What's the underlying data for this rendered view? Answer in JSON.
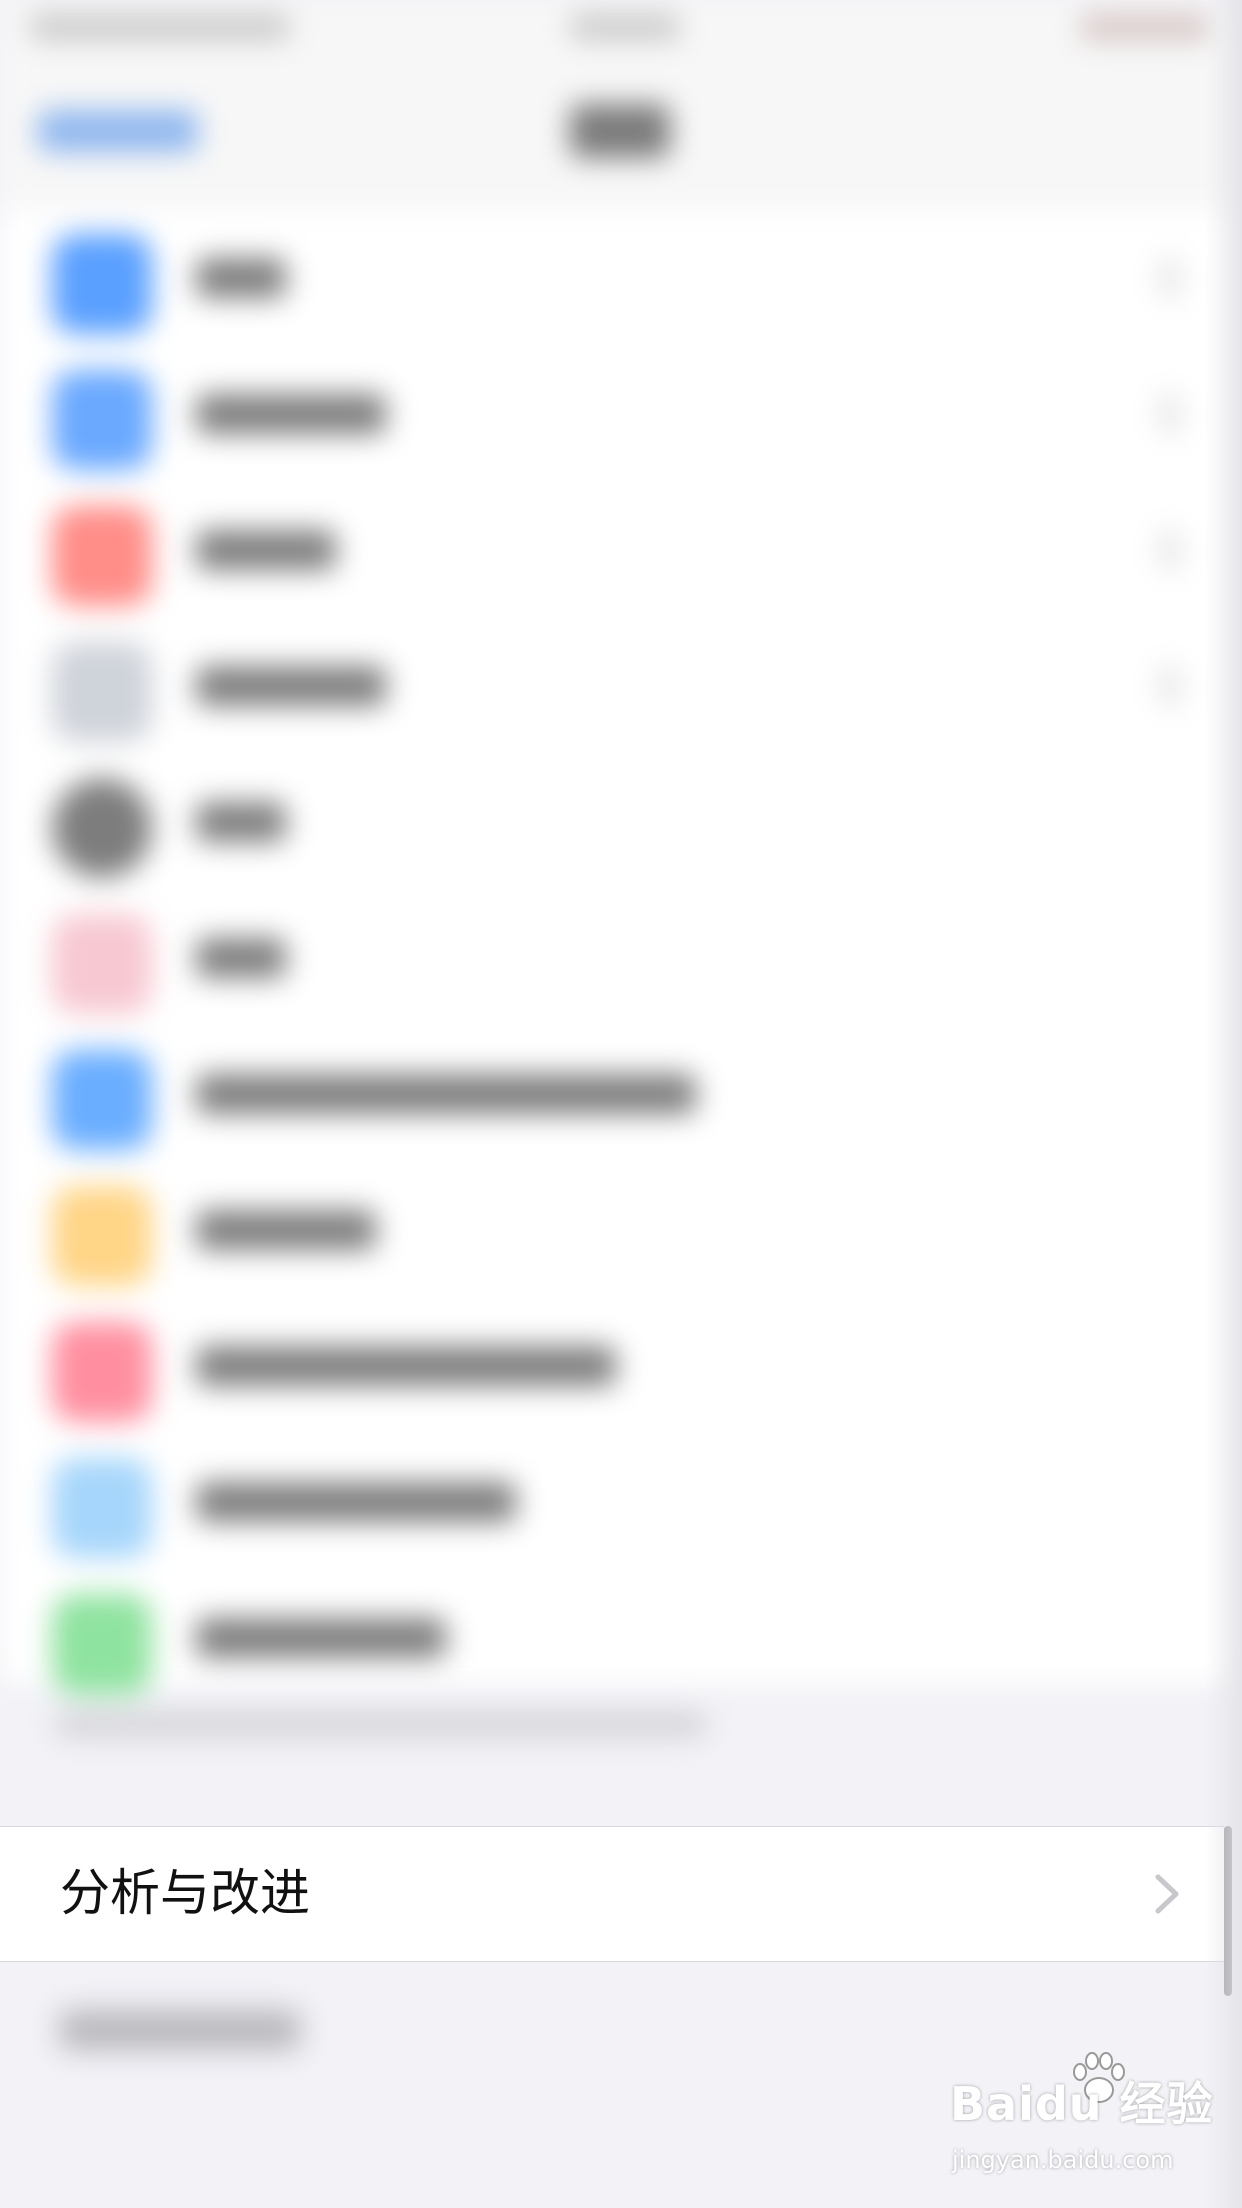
{
  "cell": {
    "label": "分析与改进"
  },
  "blurred_rows": [
    {
      "icon_color": "#5aa0ff"
    },
    {
      "icon_color": "#6aa9ff"
    },
    {
      "icon_color": "#ff8d88"
    },
    {
      "icon_color": "#cfd3da"
    },
    {
      "icon_color": "#7d7d7d"
    },
    {
      "icon_color": "#f7c8d2"
    },
    {
      "icon_color": "#6aaeff"
    },
    {
      "icon_color": "#ffd587"
    },
    {
      "icon_color": "#ff8fa0"
    },
    {
      "icon_color": "#a6d6fb"
    },
    {
      "icon_color": "#8fe3a0"
    }
  ],
  "watermark": {
    "brand": "Baidu 经验",
    "sub": "jingyan.baidu.com"
  },
  "colors": {
    "background": "#f2f2f7",
    "cell_bg": "#ffffff",
    "chevron": "#c7c7cc",
    "label": "#111111"
  },
  "icons": {
    "chevron": "chevron-right-icon",
    "watermark_logo": "paw-icon"
  }
}
